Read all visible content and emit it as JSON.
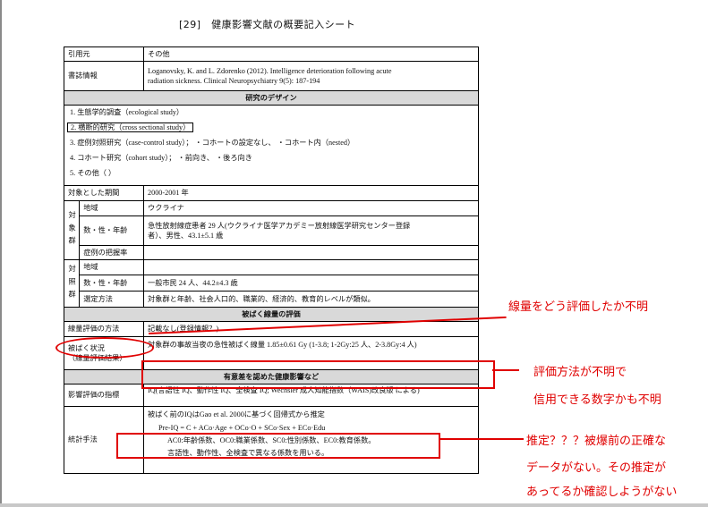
{
  "doc": {
    "title": "[29]　健康影響文献の概要記入シート"
  },
  "rows": {
    "source": {
      "label": "引用元",
      "value": "その他"
    },
    "biblio": {
      "label": "書誌情報",
      "line1": "Loganovsky, K. and L. Zdorenko (2012). Intelligence deterioration following acute",
      "line2": "radiation sickness. Clinical Neuropsychiatry 9(5): 187-194"
    },
    "design_header": "研究のデザイン",
    "design": [
      "1.  生態学的調査（ecological study）",
      "2.  横断的研究（cross sectional study）",
      "3.  症例対照研究（case-control study）；  ・コホートの設定なし、      ・コホート内（nested）",
      "4.  コホート研究（cohort study）；  ・前向き、      ・後ろ向き",
      "5.  その他（                                                                                                                              ）"
    ],
    "period": {
      "label": "対象とした期間",
      "value": "2000-2001 年"
    },
    "subject_group": {
      "vertical": "対象群",
      "region_label": "地域",
      "region": "ウクライナ",
      "count_label": "数・性・年齢",
      "count1": "急性放射線症患者 29 人(ウクライナ医学アカデミー放射線医学研究センター登録",
      "count2": "者）、男性、43.1±5.1 歳",
      "grasp_label": "症例の把握率",
      "grasp": ""
    },
    "control_group": {
      "vertical": "対照群",
      "region_label": "地域",
      "region": "",
      "count_label": "数・性・年齢",
      "count": "一般市民 24 人、44.2±4.3 歳",
      "method_label": "選定方法",
      "method": "対象群と年齢、社会人口的、職業的、経済的、教育的レベルが類似。"
    },
    "exposure_header": "被ばく線量の評価",
    "exposure_method": {
      "label": "線量評価の方法",
      "value": "記載なし(登録情報？)"
    },
    "exposure_status": {
      "label1": "被ばく状況",
      "label2": "（線量評価結果）",
      "value": "対象群の事故当夜の急性被ばく線量 1.85±0.61 Gy (1-3.8; 1-2Gy:25 人、2-3.8Gy:4 人)"
    },
    "effect_header": "有意差を認めた健康影響など",
    "effect_index": {
      "label": "影響評価の指標",
      "value": "IQ(言語性 IQ、動作性 IQ、全検査 IQ; Wechsler 成人知能指数（WAIS)改良版  による)"
    },
    "stats": {
      "label": "統計手法",
      "line1": "被ばく前のIQはGao et al. 2000に基づく回帰式から推定",
      "line2": "Pre-IQ = C + ACo·Age + OCo·O + SCo·Sex + ECo·Edu",
      "line3": "AC0:年齢係数、OC0:職業係数、SC0:性別係数、EC0:教育係数。",
      "line4": "言語性、動作性、全検査で異なる係数を用いる。"
    }
  },
  "annotations": {
    "note1": "線量をどう評価したか不明",
    "note2a": "評価方法が不明で",
    "note2b": "信用できる数字かも不明",
    "note3a": "推定？？？被爆前の正確な",
    "note3b": "データがない。その推定が",
    "note3c": "あってるか確認しようがない",
    "color": "#e00000"
  }
}
